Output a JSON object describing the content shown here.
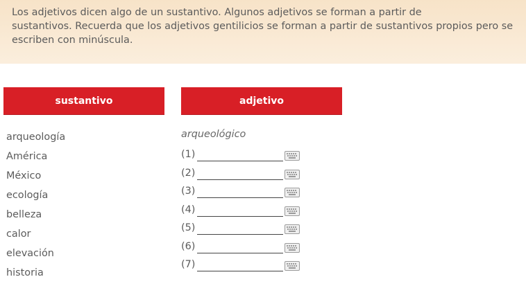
{
  "instructions": {
    "line1": "Los adjetivos dicen algo de un sustantivo. Algunos adjetivos se forman a partir de",
    "line2": "sustantivos. Recuerda que los adjetivos gentilicios se forman a partir de sustantivos propios pero se",
    "line3": "escriben con minúscula."
  },
  "table": {
    "header_sustantivo": "sustantivo",
    "header_adjetivo": "adjetivo",
    "example": "arqueológico",
    "nouns": [
      "arqueología",
      "América",
      "México",
      "ecología",
      "belleza",
      "calor",
      "elevación",
      "historia"
    ],
    "answers": [
      {
        "label": "(1)",
        "value": ""
      },
      {
        "label": "(2)",
        "value": ""
      },
      {
        "label": "(3)",
        "value": ""
      },
      {
        "label": "(4)",
        "value": ""
      },
      {
        "label": "(5)",
        "value": ""
      },
      {
        "label": "(6)",
        "value": ""
      },
      {
        "label": "(7)",
        "value": ""
      }
    ]
  },
  "colors": {
    "header_red": "#d81f26",
    "banner": "#f7e3c8",
    "text": "#5b5b5b"
  },
  "icons": {
    "keyboard": "keyboard-icon"
  }
}
